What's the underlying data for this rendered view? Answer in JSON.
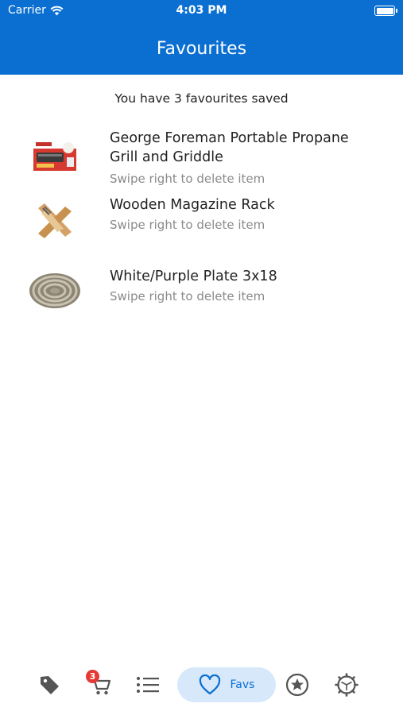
{
  "status_bar": {
    "carrier": "Carrier",
    "time": "4:03 PM"
  },
  "header": {
    "title": "Favourites",
    "background_color": "#0a6fd1"
  },
  "summary": "You have 3 favourites saved",
  "favourites": [
    {
      "title": "George Foreman Portable Propane Grill and Griddle",
      "hint": "Swipe right to delete item",
      "image": "grill-thumbnail"
    },
    {
      "title": "Wooden Magazine Rack",
      "hint": "Swipe right to delete item",
      "image": "magazine-rack-thumbnail"
    },
    {
      "title": "White/Purple Plate 3x18",
      "hint": "Swipe right to delete item",
      "image": "coil-plate-thumbnail"
    }
  ],
  "tab_bar": {
    "tabs": [
      {
        "name": "deals",
        "icon": "tag-icon"
      },
      {
        "name": "cart",
        "icon": "cart-icon",
        "badge": "3"
      },
      {
        "name": "list",
        "icon": "list-icon"
      },
      {
        "name": "favs",
        "icon": "heart-icon",
        "label": "Favs",
        "active": true
      },
      {
        "name": "featured",
        "icon": "star-circle-icon"
      },
      {
        "name": "settings",
        "icon": "gear-icon"
      }
    ],
    "active_color": "#0a6fd1",
    "active_bg_color": "#d7e8fb"
  }
}
